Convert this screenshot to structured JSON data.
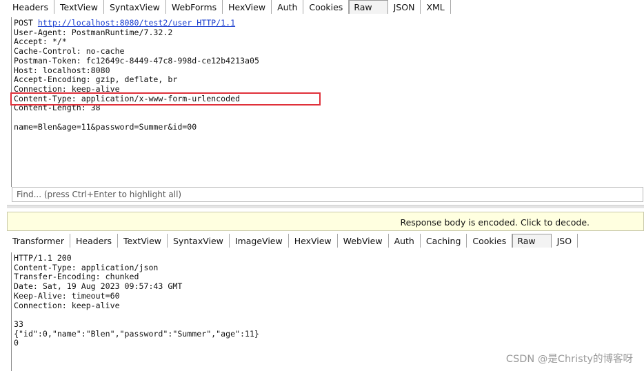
{
  "request": {
    "tabs": [
      "Headers",
      "TextView",
      "SyntaxView",
      "WebForms",
      "HexView",
      "Auth",
      "Cookies",
      "Raw",
      "JSON",
      "XML"
    ],
    "active_tab": "Raw",
    "method": "POST",
    "url": "http://localhost:8080/test2/user HTTP/1.1",
    "headers": [
      "User-Agent: PostmanRuntime/7.32.2",
      "Accept: */*",
      "Cache-Control: no-cache",
      "Postman-Token: fc12649c-8449-47c8-998d-ce12b4213a05",
      "Host: localhost:8080",
      "Accept-Encoding: gzip, deflate, br",
      "Connection: keep-alive",
      "Content-Type: application/x-www-form-urlencoded",
      "Content-Length: 38"
    ],
    "body": "name=Blen&age=11&password=Summer&id=00",
    "highlight_color": "#e0303a"
  },
  "find_bar": {
    "placeholder": "Find... (press Ctrl+Enter to highlight all)"
  },
  "notice": {
    "text": "Response body is encoded. Click to decode."
  },
  "response": {
    "tabs": [
      "Transformer",
      "Headers",
      "TextView",
      "SyntaxView",
      "ImageView",
      "HexView",
      "WebView",
      "Auth",
      "Caching",
      "Cookies",
      "Raw",
      "JSO"
    ],
    "active_tab": "Raw",
    "lines": [
      "HTTP/1.1 200",
      "Content-Type: application/json",
      "Transfer-Encoding: chunked",
      "Date: Sat, 19 Aug 2023 09:57:43 GMT",
      "Keep-Alive: timeout=60",
      "Connection: keep-alive",
      "",
      "33",
      "{\"id\":0,\"name\":\"Blen\",\"password\":\"Summer\",\"age\":11}",
      "0"
    ]
  },
  "watermark": "CSDN @是Christy的博客呀"
}
